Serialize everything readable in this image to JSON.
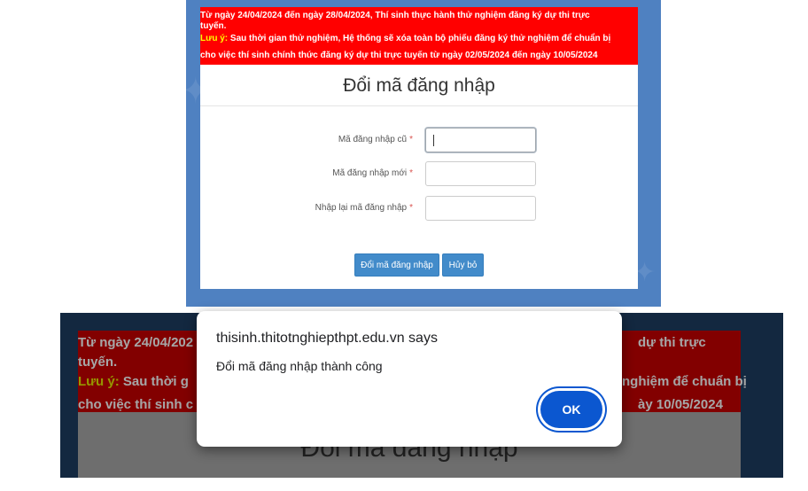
{
  "top": {
    "notice": {
      "line1": "Từ ngày 24/04/2024 đến ngày 28/04/2024, Thí sinh thực hành thử nghiệm đăng ký dự thi trực",
      "line2": "tuyến.",
      "warning_label": "Lưu ý:",
      "warning_text_1": " Sau thời gian thử nghiệm, Hệ thống sẽ xóa toàn bộ phiếu đăng ký thử nghiệm để chuẩn bị",
      "warning_text_2": "cho việc thí sinh chính thức đăng ký dự thi trực tuyến từ ngày 02/05/2024 đến ngày 10/05/2024"
    },
    "title": "Đổi mã đăng nhập",
    "fields": {
      "old_label": "Mã đăng nhập cũ",
      "new_label": "Mã đăng nhập mới",
      "confirm_label": "Nhập lại mã đăng nhập",
      "required_mark": "*"
    },
    "buttons": {
      "submit": "Đổi mã đăng nhập",
      "cancel": "Hủy bỏ"
    }
  },
  "bottom": {
    "notice": {
      "line1_left": "Từ ngày 24/04/202",
      "line1_right": "dự thi trực",
      "line2": "tuyến.",
      "warn_label": "Lưu ý:",
      "warn_left": " Sau thời g",
      "warn_right": "nghiệm để chuẩn bị",
      "line4_left": "cho việc thí sinh c",
      "line4_right": "ày 10/05/2024"
    },
    "title": "Đổi mã đăng nhập"
  },
  "dialog": {
    "title": "thisinh.thitotnghiepthpt.edu.vn says",
    "message": "Đổi mã đăng nhập thành công",
    "ok_label": "OK"
  }
}
